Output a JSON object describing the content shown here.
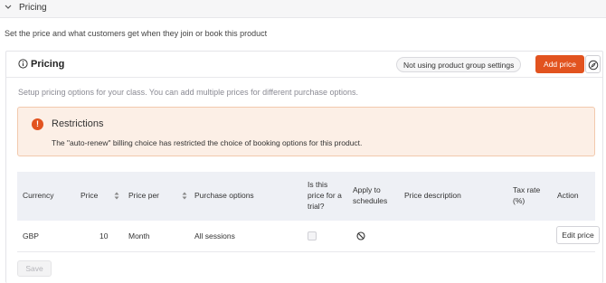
{
  "section": {
    "title": "Pricing",
    "intro": "Set the price and what customers get when they join or book this product"
  },
  "card": {
    "title": "Pricing",
    "group_settings_label": "Not using product group settings",
    "add_price_label": "Add price",
    "setup_text": "Setup pricing options for your class. You can add multiple prices for different purchase options."
  },
  "alert": {
    "title": "Restrictions",
    "text": "The \"auto-renew\" billing choice has restricted the choice of booking options for this product."
  },
  "table": {
    "headers": {
      "currency": "Currency",
      "price": "Price",
      "price_per": "Price per",
      "purchase_options": "Purchase options",
      "trial_1": "Is this",
      "trial_2": "price for a",
      "trial_3": "trial?",
      "apply_1": "Apply to",
      "apply_2": "schedules",
      "description": "Price description",
      "tax_1": "Tax rate",
      "tax_2": "(%)",
      "action": "Action"
    },
    "rows": [
      {
        "currency": "GBP",
        "price": "10",
        "price_per": "Month",
        "purchase_options": "All sessions",
        "trial_checked": false,
        "description": "",
        "tax_rate": "",
        "edit_label": "Edit price"
      }
    ]
  },
  "footer": {
    "save_label": "Save"
  },
  "colors": {
    "accent": "#e2531f",
    "alert_bg": "#fcefe6",
    "header_bg": "#eef0f5"
  },
  "icons": [
    "chevron-down-icon",
    "info-icon",
    "compass-icon",
    "alert-exclamation-icon",
    "sort-icon",
    "ban-icon"
  ]
}
